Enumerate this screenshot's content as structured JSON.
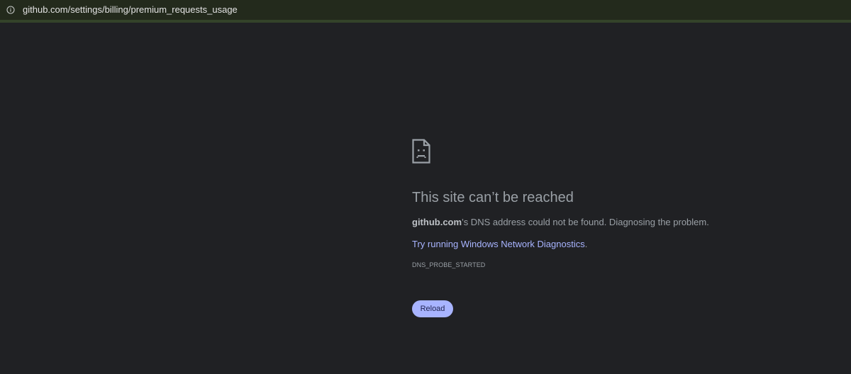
{
  "address_bar": {
    "icon": "info-icon",
    "url": "github.com/settings/billing/premium_requests_usage"
  },
  "error_page": {
    "icon": "sad-document-icon",
    "title": "This site can’t be reached",
    "description_host": "github.com",
    "description_rest": "’s DNS address could not be found. Diagnosing the problem.",
    "suggestion_prefix": "Try running ",
    "suggestion_link": "Windows Network Diagnostics",
    "suggestion_suffix": ".",
    "error_code": "DNS_PROBE_STARTED",
    "reload_label": "Reload"
  },
  "colors": {
    "background": "#202124",
    "address_bar": "#232a1c",
    "link": "#a8b4ff",
    "button": "#a8b4ff"
  }
}
